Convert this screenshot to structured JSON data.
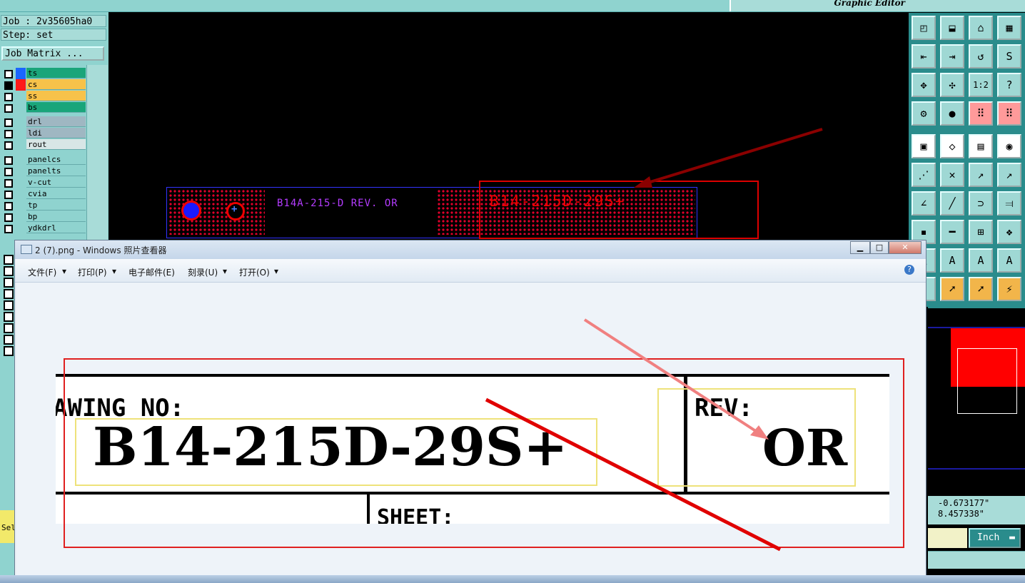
{
  "app": {
    "subtitle": "Graphic Editor"
  },
  "left_panel": {
    "job_label": "Job : 2v35605ha0",
    "step_label": "Step: set",
    "job_matrix_button": "Job Matrix ...",
    "layers_group1": [
      {
        "name": "ts",
        "color": "#1a66ff",
        "bg": "#1aa57a"
      },
      {
        "name": "cs",
        "color": "#ff1a1a",
        "bg": "#f7c24a"
      },
      {
        "name": "ss",
        "color": "",
        "bg": "#f7c24a"
      },
      {
        "name": "bs",
        "color": "",
        "bg": "#1aa57a"
      }
    ],
    "layers_group2": [
      {
        "name": "drl",
        "bg": "#9fb7c2"
      },
      {
        "name": "ldi",
        "bg": "#9fb7c2"
      },
      {
        "name": "rout",
        "bg": "#d8e6e6"
      }
    ],
    "layers_group3": [
      {
        "name": "panelcs",
        "bg": "#8fd3cf"
      },
      {
        "name": "panelts",
        "bg": "#8fd3cf"
      },
      {
        "name": "v-cut",
        "bg": "#8fd3cf"
      },
      {
        "name": "cvia",
        "bg": "#8fd3cf"
      },
      {
        "name": "tp",
        "bg": "#8fd3cf"
      },
      {
        "name": "bp",
        "bg": "#8fd3cf"
      },
      {
        "name": "ydkdrl",
        "bg": "#8fd3cf"
      }
    ],
    "partial_label": "Sel"
  },
  "canvas": {
    "silkscreen_text": "B14A-215-D REV. OR",
    "copper_text": "B14-215D-29S+"
  },
  "right_panel": {
    "coord_x": "-0.673177\"",
    "coord_y": "8.457338\"",
    "unit_button": "Inch",
    "toolbar_labels": {
      "ratio": "1:2",
      "help": "?"
    }
  },
  "viewer": {
    "title": "2 (7).png - Windows 照片查看器",
    "menu": [
      "文件(F)",
      "打印(P)",
      "电子邮件(E)",
      "刻录(U)",
      "打开(O)"
    ],
    "drawing": {
      "drawing_no_label": "AWING NO:",
      "drawing_no_value": "B14-215D-29S+",
      "rev_label": "REV:",
      "rev_value": "OR",
      "sheet_label": "SHEET:"
    }
  }
}
